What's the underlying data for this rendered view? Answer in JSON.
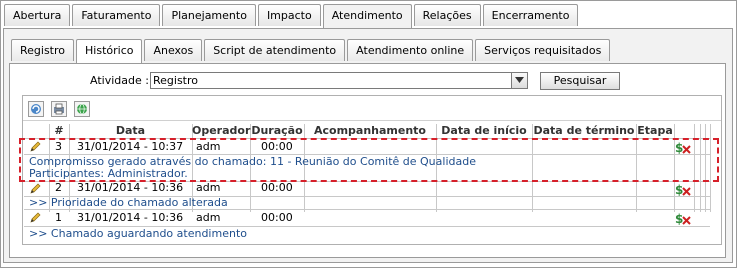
{
  "top_tabs": [
    {
      "label": "Abertura",
      "active": false
    },
    {
      "label": "Faturamento",
      "active": false
    },
    {
      "label": "Planejamento",
      "active": false
    },
    {
      "label": "Impacto",
      "active": false
    },
    {
      "label": "Atendimento",
      "active": true
    },
    {
      "label": "Relações",
      "active": false
    },
    {
      "label": "Encerramento",
      "active": false
    }
  ],
  "sub_tabs": [
    {
      "label": "Registro",
      "active": false
    },
    {
      "label": "Histórico",
      "active": true
    },
    {
      "label": "Anexos",
      "active": false
    },
    {
      "label": "Script de atendimento",
      "active": false
    },
    {
      "label": "Atendimento online",
      "active": false
    },
    {
      "label": "Serviços requisitados",
      "active": false
    }
  ],
  "filter": {
    "label": "Atividade :",
    "selected": "Registro",
    "search_button": "Pesquisar"
  },
  "toolbar": {
    "icons": [
      "refresh-icon",
      "print-icon",
      "globe-icon"
    ]
  },
  "table": {
    "headers": {
      "num": "#",
      "data": "Data",
      "operador": "Operador",
      "duracao": "Duração",
      "acompanhamento": "Acompanhamento",
      "data_inicio": "Data de início",
      "data_termino": "Data de término",
      "etapa": "Etapa"
    },
    "rows": [
      {
        "num": "3",
        "data": "31/01/2014 - 10:37",
        "operador": "adm",
        "duracao": "00:00",
        "desc1": "Compromisso gerado através do chamado: 11 - Reunião do Comitê de Qualidade",
        "desc2": "Participantes: Administrador."
      },
      {
        "num": "2",
        "data": "31/01/2014 - 10:36",
        "operador": "adm",
        "duracao": "00:00",
        "desc1": ">> Prioridade do chamado alterada"
      },
      {
        "num": "1",
        "data": "31/01/2014 - 10:36",
        "operador": "adm",
        "duracao": "00:00",
        "desc1": ">> Chamado aguardando atendimento"
      }
    ]
  },
  "colors": {
    "link_text": "#1f4e8c",
    "highlight": "#d6202a"
  }
}
